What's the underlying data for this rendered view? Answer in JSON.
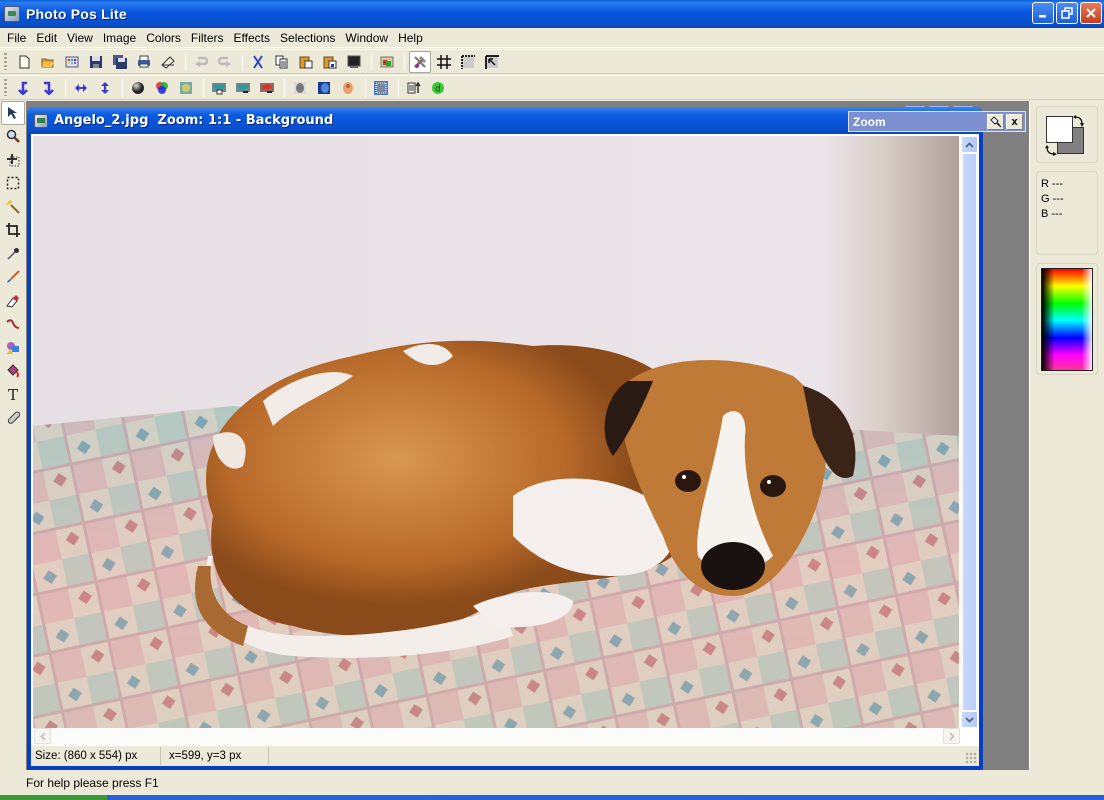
{
  "window": {
    "title": "Photo Pos Lite",
    "controls": {
      "minimize": "minimize",
      "maximize": "restore",
      "close": "close"
    }
  },
  "menu": [
    "File",
    "Edit",
    "View",
    "Image",
    "Colors",
    "Filters",
    "Effects",
    "Selections",
    "Window",
    "Help"
  ],
  "toolbar1": [
    {
      "name": "new-file-icon"
    },
    {
      "name": "open-folder-icon"
    },
    {
      "name": "browse-gallery-icon"
    },
    {
      "name": "save-icon"
    },
    {
      "name": "save-all-icon"
    },
    {
      "name": "print-icon"
    },
    {
      "name": "scan-icon"
    },
    {
      "sep": true
    },
    {
      "name": "undo-icon",
      "disabled": true
    },
    {
      "name": "redo-icon",
      "disabled": true
    },
    {
      "sep": true
    },
    {
      "name": "cut-icon"
    },
    {
      "name": "copy-icon"
    },
    {
      "name": "paste-icon"
    },
    {
      "name": "paste-new-icon"
    },
    {
      "name": "fullscreen-icon"
    },
    {
      "sep": true
    },
    {
      "name": "layers-icon"
    },
    {
      "sep": true
    },
    {
      "name": "tools-icon",
      "pressed": true
    },
    {
      "name": "grid-icon"
    },
    {
      "name": "ruler-icon"
    },
    {
      "name": "cursor-guide-icon"
    }
  ],
  "toolbar2": [
    {
      "name": "rotate-left-icon"
    },
    {
      "name": "rotate-right-icon"
    },
    {
      "sep": true
    },
    {
      "name": "flip-horizontal-icon"
    },
    {
      "name": "flip-vertical-icon"
    },
    {
      "sep": true
    },
    {
      "name": "grayscale-icon"
    },
    {
      "name": "color-balance-icon"
    },
    {
      "name": "hue-icon"
    },
    {
      "sep": true
    },
    {
      "name": "red-eye-auto-icon"
    },
    {
      "name": "red-eye-remove-icon"
    },
    {
      "name": "red-eye-fix-icon"
    },
    {
      "sep": true
    },
    {
      "name": "sepia-icon"
    },
    {
      "name": "blue-tone-icon"
    },
    {
      "name": "warm-tone-icon"
    },
    {
      "sep": true
    },
    {
      "name": "frame-icon"
    },
    {
      "sep": true
    },
    {
      "name": "export-icon"
    },
    {
      "name": "plugin-d-icon"
    }
  ],
  "tools": [
    {
      "name": "pointer-tool-icon",
      "active": true
    },
    {
      "name": "zoom-tool-icon"
    },
    {
      "name": "move-selection-tool-icon"
    },
    {
      "name": "rect-select-tool-icon"
    },
    {
      "name": "magic-wand-tool-icon"
    },
    {
      "name": "crop-tool-icon"
    },
    {
      "name": "eyedropper-tool-icon"
    },
    {
      "name": "brush-tool-icon"
    },
    {
      "name": "eraser-tool-icon"
    },
    {
      "name": "pen-tool-icon"
    },
    {
      "name": "shapes-tool-icon"
    },
    {
      "name": "fill-bucket-tool-icon"
    },
    {
      "name": "text-tool-icon"
    },
    {
      "name": "clone-tool-icon"
    }
  ],
  "image_window": {
    "filename": "Angelo_2.jpg",
    "title": "Angelo_2.jpg  Zoom: 1:1 - Background",
    "size_text": "Size: (860 x 554) px",
    "coords_text": "x=599, y=3 px"
  },
  "zoom_panel": {
    "title": "Zoom",
    "pin": "pin",
    "close": "x"
  },
  "color_panel": {
    "foreground": "#ffffff",
    "background": "#808080",
    "r": "R ---",
    "g": "G ---",
    "b": "B ---"
  },
  "statusbar": {
    "help": "For help please press F1"
  },
  "glyphs": {
    "tool_text": "T"
  }
}
